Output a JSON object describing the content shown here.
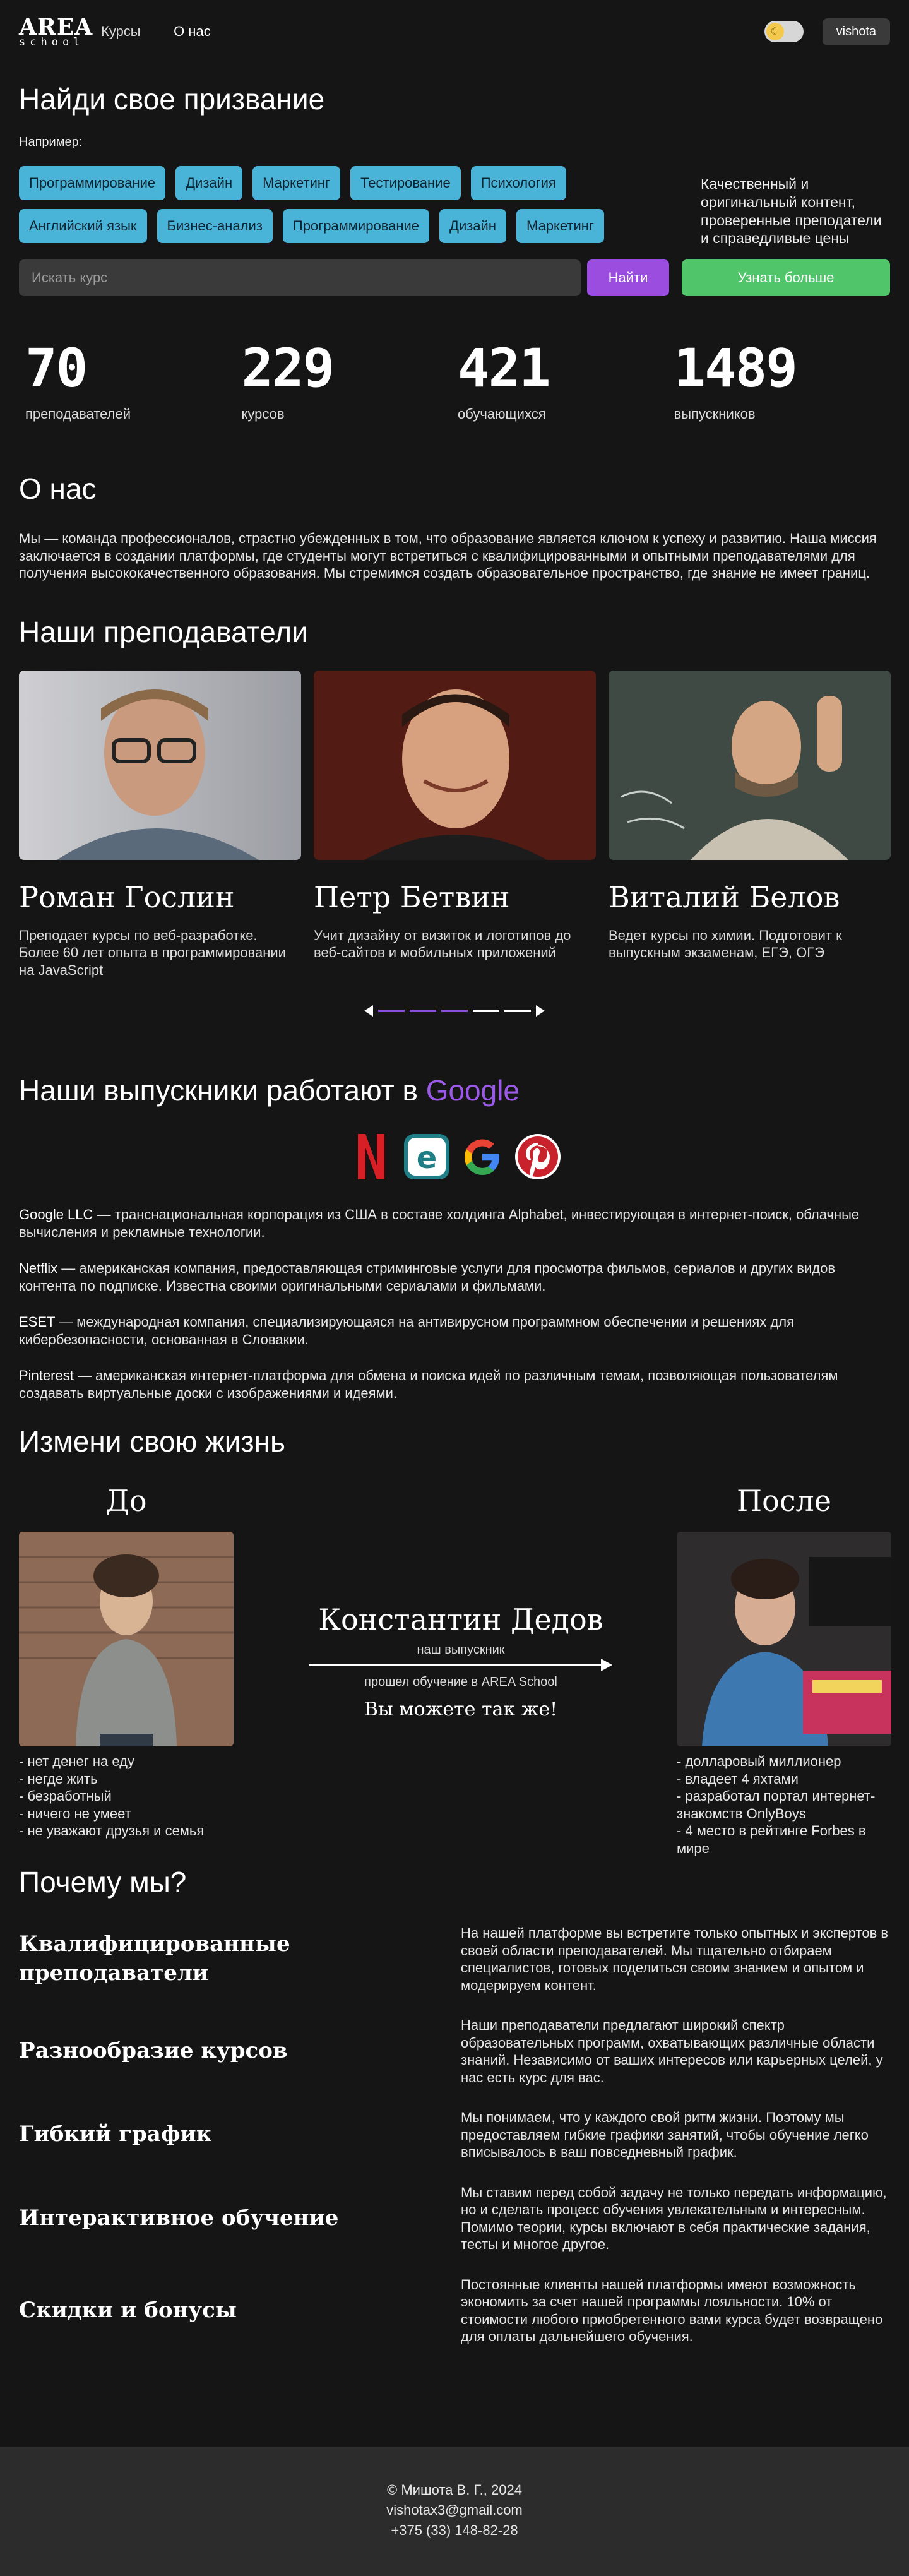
{
  "header": {
    "logo_top": "AREA",
    "logo_bottom": "school",
    "nav": [
      "Курсы",
      "О нас"
    ],
    "user": "vishota"
  },
  "hero": {
    "title": "Найди свое призвание",
    "example_label": "Например:",
    "tags_row1": [
      "Программирование",
      "Дизайн",
      "Маркетинг",
      "Тестирование",
      "Психология"
    ],
    "tags_row2": [
      "Английский язык",
      "Бизнес-анализ",
      "Программирование",
      "Дизайн",
      "Маркетинг"
    ],
    "side_text": "Качественный и оригинальный контент, проверенные преподатели и справедливые цены",
    "search_placeholder": "Искать курс",
    "find_button": "Найти",
    "more_button": "Узнать больше"
  },
  "stats": [
    {
      "num": "70",
      "label": "преподавателей"
    },
    {
      "num": "229",
      "label": "курсов"
    },
    {
      "num": "421",
      "label": "обучающихся"
    },
    {
      "num": "1489",
      "label": "выпускников"
    }
  ],
  "about": {
    "title": "О нас",
    "text": "Мы — команда профессионалов, страстно убежденных в том, что образование является ключом к успеху и развитию. Наша миссия заключается в создании платформы, где студенты могут встретиться с квалифицированными и опытными преподавателями для получения высококачественного образования. Мы стремимся создать образовательное пространство, где знание не имеет границ."
  },
  "teachers": {
    "title": "Наши преподаватели",
    "items": [
      {
        "name": "Роман Гослин",
        "desc": "Преподает курсы по веб-разработке. Более 60 лет опыта в программировании на JavaScript"
      },
      {
        "name": "Петр Бетвин",
        "desc": "Учит дизайну от визиток и логотипов до веб-сайтов и мобильных приложений"
      },
      {
        "name": "Виталий Белов",
        "desc": "Ведет курсы по химии. Подготовит к выпускным экзаменам, ЕГЭ, ОГЭ"
      }
    ]
  },
  "alumni": {
    "title": "Наши выпускники работают в",
    "accent": "Google",
    "logos": [
      "netflix-icon",
      "eset-icon",
      "google-icon",
      "pinterest-icon"
    ],
    "companies": [
      {
        "name": "Google LLC",
        "text": " — транснациональная корпорация из США в составе холдинга Alphabet, инвестирующая в интернет-поиск, облачные вычисления и рекламные технологии."
      },
      {
        "name": "Netflix",
        "text": " — американская компания, предоставляющая стриминговые услуги для просмотра фильмов, сериалов и других видов контента по подписке. Известна своими оригинальными сериалами и фильмами."
      },
      {
        "name": "ESET",
        "text": " — международная компания, специализирующаяся на антивирусном программном обеспечении и решениях для кибербезопасности, основанная в Словакии."
      },
      {
        "name": "Pinterest",
        "text": " — американская интернет-платформа для обмена и поиска идей по различным темам, позволяющая пользователям создавать виртуальные доски с изображениями и идеями."
      }
    ]
  },
  "change": {
    "title": "Измени свою жизнь",
    "before_title": "До",
    "after_title": "После",
    "name": "Константин Дедов",
    "subtitle": "наш выпускник",
    "caption": "прошел обучение в AREA School",
    "cta": "Вы можете так же!",
    "before_list": [
      "- нет денег на еду",
      "- негде жить",
      "- безработный",
      "- ничего не умеет",
      "- не уважают друзья и семья"
    ],
    "after_list": [
      "- долларовый миллионер",
      "- владеет 4 яхтами",
      "- разработал портал интернет-знакомств OnlyBoys",
      "- 4 место в рейтинге Forbes в мире"
    ]
  },
  "why": {
    "title": "Почему мы?",
    "items": [
      {
        "title": "Квалифицированные преподаватели",
        "text": "На нашей платформе вы встретите только опытных и экспертов в своей области преподавателей. Мы тщательно отбираем специалистов, готовых поделиться своим знанием и опытом и модерируем контент."
      },
      {
        "title": "Разнообразие курсов",
        "text": "Наши преподаватели предлагают широкий спектр образовательных программ, охватывающих различные области знаний. Независимо от ваших интересов или карьерных целей, у нас есть курс для вас."
      },
      {
        "title": "Гибкий график",
        "text": "Мы понимаем, что у каждого свой ритм жизни. Поэтому мы предоставляем гибкие графики занятий, чтобы обучение легко вписывалось в ваш повседневный график."
      },
      {
        "title": "Интерактивное обучение",
        "text": "Мы ставим перед собой задачу не только передать информацию, но и сделать процесс обучения увлекательным и интересным. Помимо теории, курсы включают в себя практические задания, тесты и многое другое."
      },
      {
        "title": "Скидки и бонусы",
        "text": "Постоянные клиенты нашей платформы имеют возможность экономить за счет нашей программы лояльности. 10% от стоимости любого приобретенного вами курса будет возвращено для оплаты дальнейшего обучения."
      }
    ]
  },
  "footer": {
    "copyright": "© Мишота В. Г., 2024",
    "email": "vishotax3@gmail.com",
    "phone": "+375 (33) 148-82-28"
  }
}
